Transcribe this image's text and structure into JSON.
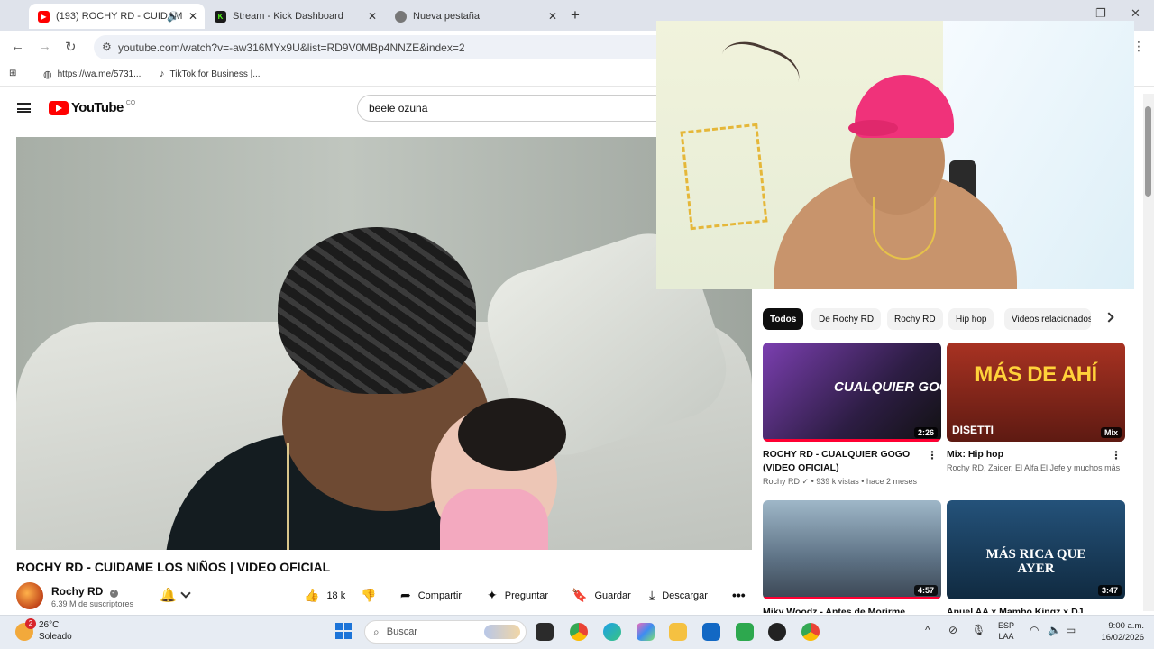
{
  "browser": {
    "tabs": [
      {
        "label": "(193) ROCHY RD - CUIDAM",
        "active": true
      },
      {
        "label": "Stream - Kick Dashboard",
        "active": false
      },
      {
        "label": "Nueva pestaña",
        "active": false
      }
    ],
    "url": "youtube.com/watch?v=-aw316MYx9U&list=RD9V0MBp4NNZE&index=2",
    "bookmarks": [
      {
        "label": "https://wa.me/5731...",
        "icon": "globe-icon"
      },
      {
        "label": "TikTok for Business |...",
        "icon": "tiktok-icon"
      }
    ]
  },
  "youtube": {
    "logo_text": "YouTube",
    "country_code": "CO",
    "search_value": "beele ozuna",
    "video": {
      "title": "ROCHY RD - CUIDAME LOS NIÑOS | VIDEO OFICIAL",
      "channel": "Rochy RD",
      "subscribers": "6.39 M de suscriptores",
      "likes": "18 k",
      "actions": {
        "share": "Compartir",
        "ask": "Preguntar",
        "save": "Guardar",
        "download": "Descargar"
      }
    },
    "chips": [
      "Todos",
      "De Rochy RD",
      "Rochy RD",
      "Hip hop",
      "Videos relacionados"
    ],
    "recommendations": [
      {
        "title": "ROCHY RD - CUALQUIER GOGO (VIDEO OFICIAL)",
        "channel": "Rochy RD",
        "views": "939 k vistas",
        "age": "hace 2 meses",
        "badge": "2:26",
        "thumb_text": "CUALQUIER GOGO",
        "thumb_color": "#4a2f6b"
      },
      {
        "title": "Mix: Hip hop",
        "channel": "Rochy RD, Zaider, El Alfa El Jefe y muchos más",
        "views": "",
        "age": "",
        "badge": "Mix",
        "thumb_text": "MÁS DE AHÍ",
        "thumb_sub": "DISETTI",
        "thumb_color": "#8a2a1e"
      },
      {
        "title": "Miky Woodz - Antes de Morirme",
        "channel": "",
        "views": "",
        "age": "",
        "badge": "4:57",
        "thumb_text": "",
        "thumb_color": "#6f8aa0"
      },
      {
        "title": "Anuel AA x Mambo Kingz x DJ Luian",
        "channel": "",
        "views": "",
        "age": "",
        "badge": "3:47",
        "thumb_text": "MÁS RICA QUE AYER",
        "thumb_color": "#1e3b5a"
      }
    ]
  },
  "taskbar": {
    "temperature": "26°C",
    "weather": "Soleado",
    "weather_badge": "2",
    "search_placeholder": "Buscar",
    "lang_1": "ESP",
    "lang_2": "LAA",
    "time": "9:00 a.m.",
    "date": "16/02/2026"
  }
}
